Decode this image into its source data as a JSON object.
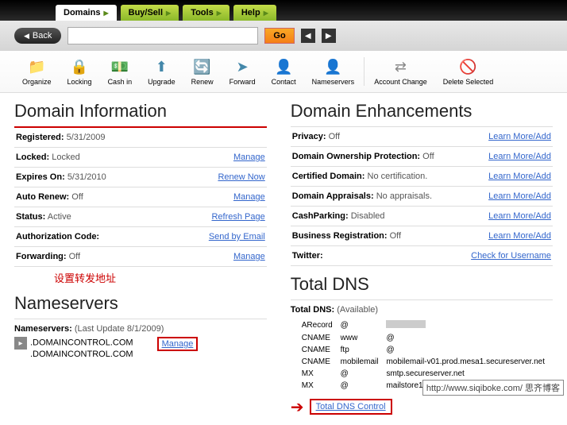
{
  "tabs": [
    {
      "l": "Domains"
    },
    {
      "l": "Buy/Sell"
    },
    {
      "l": "Tools"
    },
    {
      "l": "Help"
    }
  ],
  "back": "Back",
  "search": {
    "placeholder": "",
    "go": "Go"
  },
  "toolbar": [
    {
      "l": "Organize",
      "i": "📁",
      "c": "#e8a23a"
    },
    {
      "l": "Locking",
      "i": "🔒",
      "c": "#e8a23a"
    },
    {
      "l": "Cash in",
      "i": "💵",
      "c": "#6a6"
    },
    {
      "l": "Upgrade",
      "i": "⬆",
      "c": "#48a"
    },
    {
      "l": "Renew",
      "i": "🔄",
      "c": "#48a"
    },
    {
      "l": "Forward",
      "i": "➤",
      "c": "#48a"
    },
    {
      "l": "Contact",
      "i": "👤",
      "c": "#d88"
    },
    {
      "l": "Nameservers",
      "i": "👤",
      "c": "#e8a23a"
    },
    {
      "l": "Account Change",
      "i": "⇄",
      "c": "#888"
    },
    {
      "l": "Delete Selected",
      "i": "🚫",
      "c": "#c33"
    }
  ],
  "di": {
    "title": "Domain Information",
    "rows": [
      {
        "k": "Registered:",
        "v": "5/31/2009"
      },
      {
        "k": "Locked:",
        "v": "Locked",
        "a": "Manage"
      },
      {
        "k": "Expires On:",
        "v": "5/31/2010",
        "a": "Renew Now",
        "red": true
      },
      {
        "k": "Auto Renew:",
        "v": "Off",
        "a": "Manage"
      },
      {
        "k": "Status:",
        "v": "Active",
        "a": "Refresh Page",
        "red": true
      },
      {
        "k": "Authorization Code:",
        "v": "",
        "a": "Send by Email"
      },
      {
        "k": "Forwarding:",
        "v": "Off",
        "a": "Manage"
      }
    ],
    "note": "设置转发地址"
  },
  "de": {
    "title": "Domain Enhancements",
    "rows": [
      {
        "k": "Privacy:",
        "v": "Off",
        "a": "Learn More/Add"
      },
      {
        "k": "Domain Ownership Protection:",
        "v": "Off",
        "a": "Learn More/Add"
      },
      {
        "k": "Certified Domain:",
        "v": "No certification.",
        "a": "Learn More/Add"
      },
      {
        "k": "Domain Appraisals:",
        "v": "No appraisals.",
        "a": "Learn More/Add"
      },
      {
        "k": "CashParking:",
        "v": "Disabled",
        "a": "Learn More/Add"
      },
      {
        "k": "Business Registration:",
        "v": "Off",
        "a": "Learn More/Add"
      },
      {
        "k": "Twitter:",
        "v": "",
        "a": "Check for Username"
      }
    ]
  },
  "ns": {
    "title": "Nameservers",
    "meta": "(Last Update 8/1/2009)",
    "label": "Nameservers:",
    "servers": [
      ".DOMAINCONTROL.COM",
      ".DOMAINCONTROL.COM"
    ],
    "manage": "Manage"
  },
  "dns": {
    "title": "Total DNS",
    "avail_label": "Total DNS:",
    "avail": "(Available)",
    "records": [
      {
        "t": "ARecord",
        "h": "@",
        "v": ""
      },
      {
        "t": "CNAME",
        "h": "www",
        "v": "@"
      },
      {
        "t": "CNAME",
        "h": "ftp",
        "v": "@"
      },
      {
        "t": "CNAME",
        "h": "mobilemail",
        "v": "mobilemail-v01.prod.mesa1.secureserver.net"
      },
      {
        "t": "MX",
        "h": "@",
        "v": "smtp.secureserver.net"
      },
      {
        "t": "MX",
        "h": "@",
        "v": "mailstore1.secureserver.net"
      }
    ],
    "control": "Total DNS Control"
  },
  "watermark": "http://www.siqiboke.com/   思齐博客"
}
